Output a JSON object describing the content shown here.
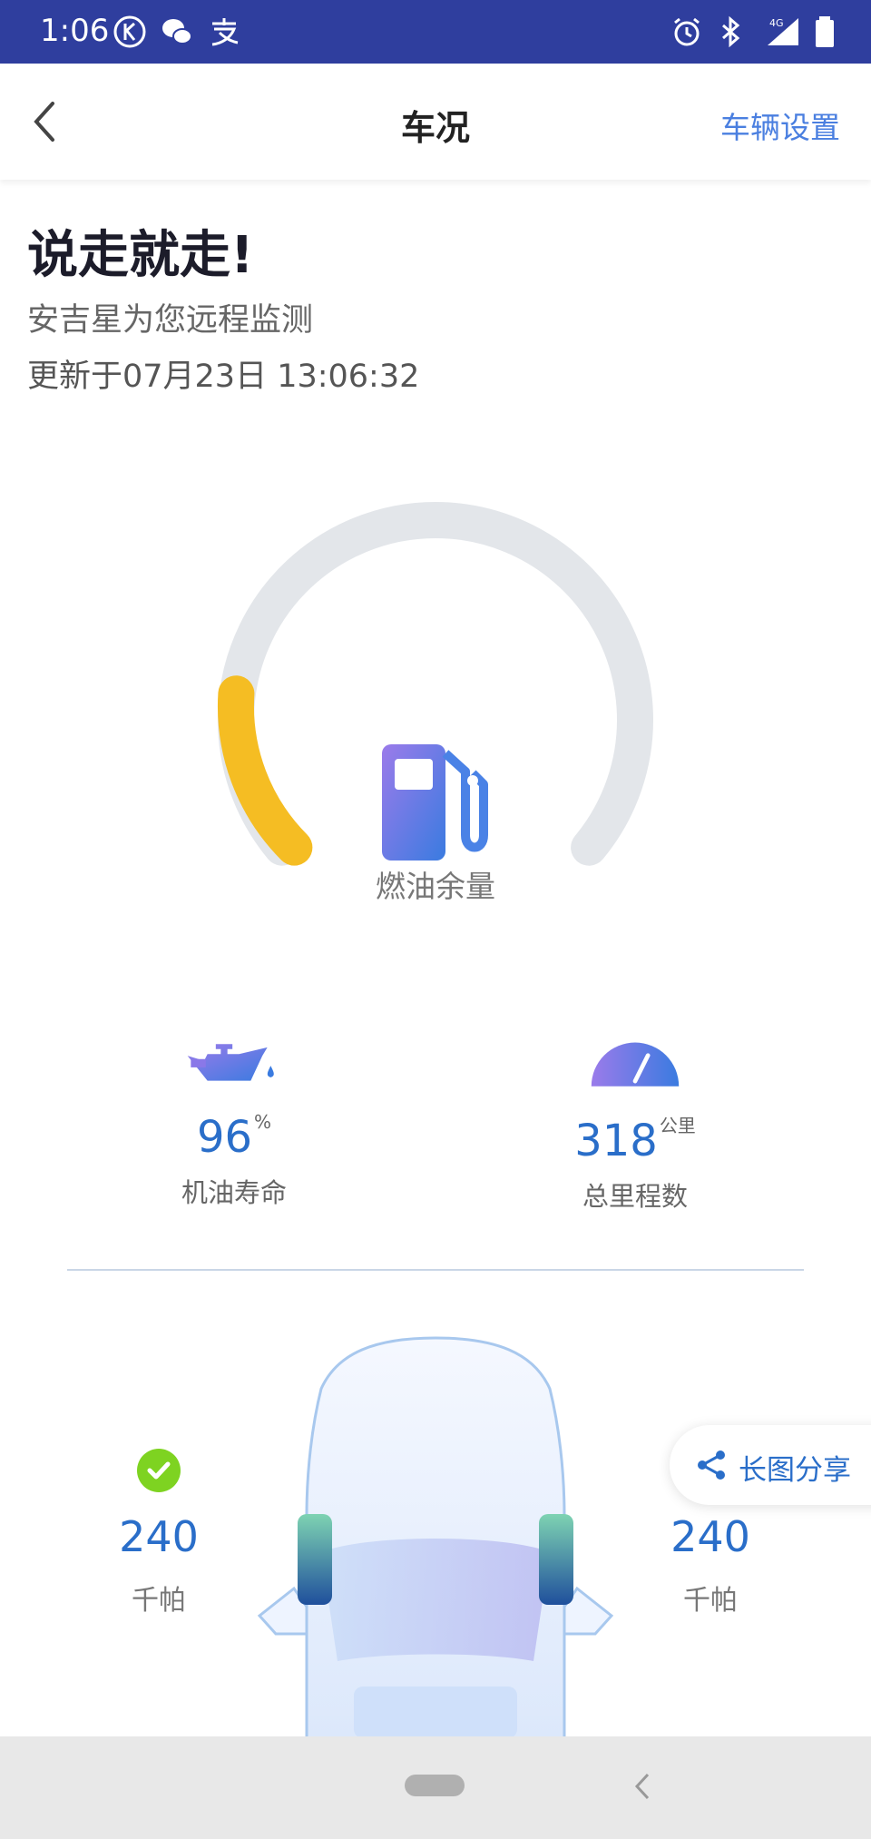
{
  "status_bar": {
    "time": "1:06",
    "network": "4G",
    "bg_color": "#2f3e9e"
  },
  "nav": {
    "title": "车况",
    "settings_label": "车辆设置"
  },
  "hero": {
    "headline": "说走就走!",
    "subtitle": "安吉星为您远程监测",
    "updated": "更新于07月23日 13:06:32"
  },
  "fuel": {
    "label": "燃油余量",
    "level_fraction": 0.18,
    "gauge_color": "#f5bd23",
    "track_color": "#e3e6ea"
  },
  "oil": {
    "value": "96",
    "unit": "%",
    "label": "机油寿命"
  },
  "mileage": {
    "value": "318",
    "unit": "公里",
    "label": "总里程数"
  },
  "tires": {
    "front_left": {
      "value": "240",
      "unit": "千帕",
      "status": "ok"
    },
    "front_right": {
      "value": "240",
      "unit": "千帕"
    }
  },
  "share": {
    "label": "长图分享"
  },
  "accent_color": "#2a6ec9"
}
